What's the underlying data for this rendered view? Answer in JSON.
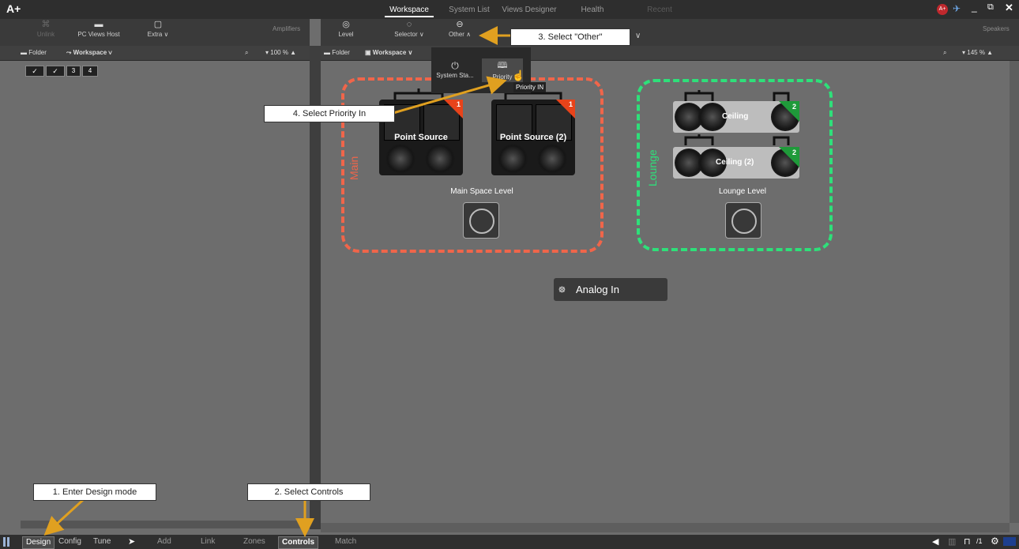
{
  "app": {
    "logo": "A+"
  },
  "title_tabs": [
    "Workspace",
    "System List",
    "Views Designer",
    "Health",
    "Recent"
  ],
  "left_toolbar": {
    "items": [
      {
        "label": "Unlink",
        "icon": "unlink-icon"
      },
      {
        "label": "PC Views Host",
        "icon": "pc-views-host-icon"
      },
      {
        "label": "Extra",
        "icon": "extra-icon"
      }
    ],
    "section": "Amplifiers"
  },
  "right_toolbar": {
    "items": [
      {
        "label": "Level",
        "icon": "level-icon"
      },
      {
        "label": "Selector",
        "icon": "selector-icon"
      },
      {
        "label": "Other",
        "icon": "other-icon"
      }
    ],
    "section": "Speakers"
  },
  "left_subbar": {
    "folder": "Folder",
    "workspace": "Workspace",
    "zoom": "100 %"
  },
  "right_subbar": {
    "folder": "Folder",
    "workspace": "Workspace",
    "zoom": "145 %"
  },
  "left_chips": [
    "✓",
    "✓",
    "3",
    "4"
  ],
  "dropdown": {
    "items": [
      {
        "label": "System Sta...",
        "icon": "power-icon"
      },
      {
        "label": "Priority",
        "icon": "book-icon"
      }
    ],
    "tooltip": "Priority IN"
  },
  "zones": {
    "main": {
      "label": "Main",
      "level": "Main Space Level",
      "color": "#f0654a"
    },
    "lounge": {
      "label": "Lounge",
      "level": "Lounge Level",
      "color": "#2ee07a"
    }
  },
  "speakers": [
    {
      "name": "Point Source",
      "badge": "1"
    },
    {
      "name": "Point Source (2)",
      "badge": "1"
    },
    {
      "name": "Ceiling",
      "badge": "2"
    },
    {
      "name": "Ceiling (2)",
      "badge": "2"
    }
  ],
  "analog_in": "Analog In",
  "callouts": {
    "c1": "1. Enter Design mode",
    "c2": "2. Select Controls",
    "c3": "3. Select \"Other\"",
    "c4": "4. Select Priority In"
  },
  "bottom_bar": {
    "modes": [
      "Design",
      "Config",
      "Tune"
    ],
    "tools": [
      "Add",
      "Link",
      "Zones",
      "Controls",
      "Match"
    ],
    "page": "/1"
  },
  "colors": {
    "annotation_arrow": "#e0a020",
    "badge_red": "#e8431a",
    "badge_green": "#1f9a3a"
  }
}
